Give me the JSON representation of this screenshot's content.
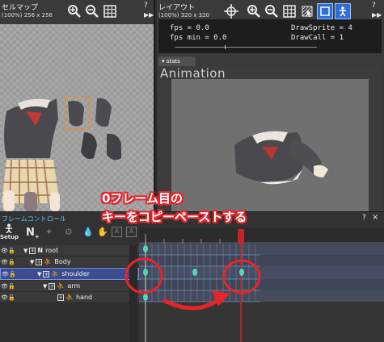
{
  "cellmap": {
    "title": "セルマップ",
    "size": "(100%) 256 x 256"
  },
  "layout": {
    "title": "レイアウト",
    "size": "(100%) 320 x 320"
  },
  "stats": {
    "fps": "fps = 0.0",
    "fps_min": "fps min = 0.0",
    "draw_sprite": "DrawSprite = 4",
    "draw_call": "DrawCall = 1",
    "tab_label": "stats"
  },
  "animation_label": "Animation",
  "frame_control": {
    "title": "フレームコントロール",
    "setup_label": "Setup"
  },
  "tree": [
    {
      "name": "root"
    },
    {
      "name": "Body"
    },
    {
      "name": "shoulder"
    },
    {
      "name": "arm"
    },
    {
      "name": "hand"
    }
  ],
  "annotation": {
    "line1": "0フレーム目の",
    "line2": "キーをコピーペーストする"
  },
  "colors": {
    "accent_red": "#e8242a",
    "keyframe": "#58d6b4",
    "selection": "#3b4d8e",
    "title_blue": "#66c8ff"
  },
  "panel_controls": {
    "help": "?",
    "close": "×"
  }
}
